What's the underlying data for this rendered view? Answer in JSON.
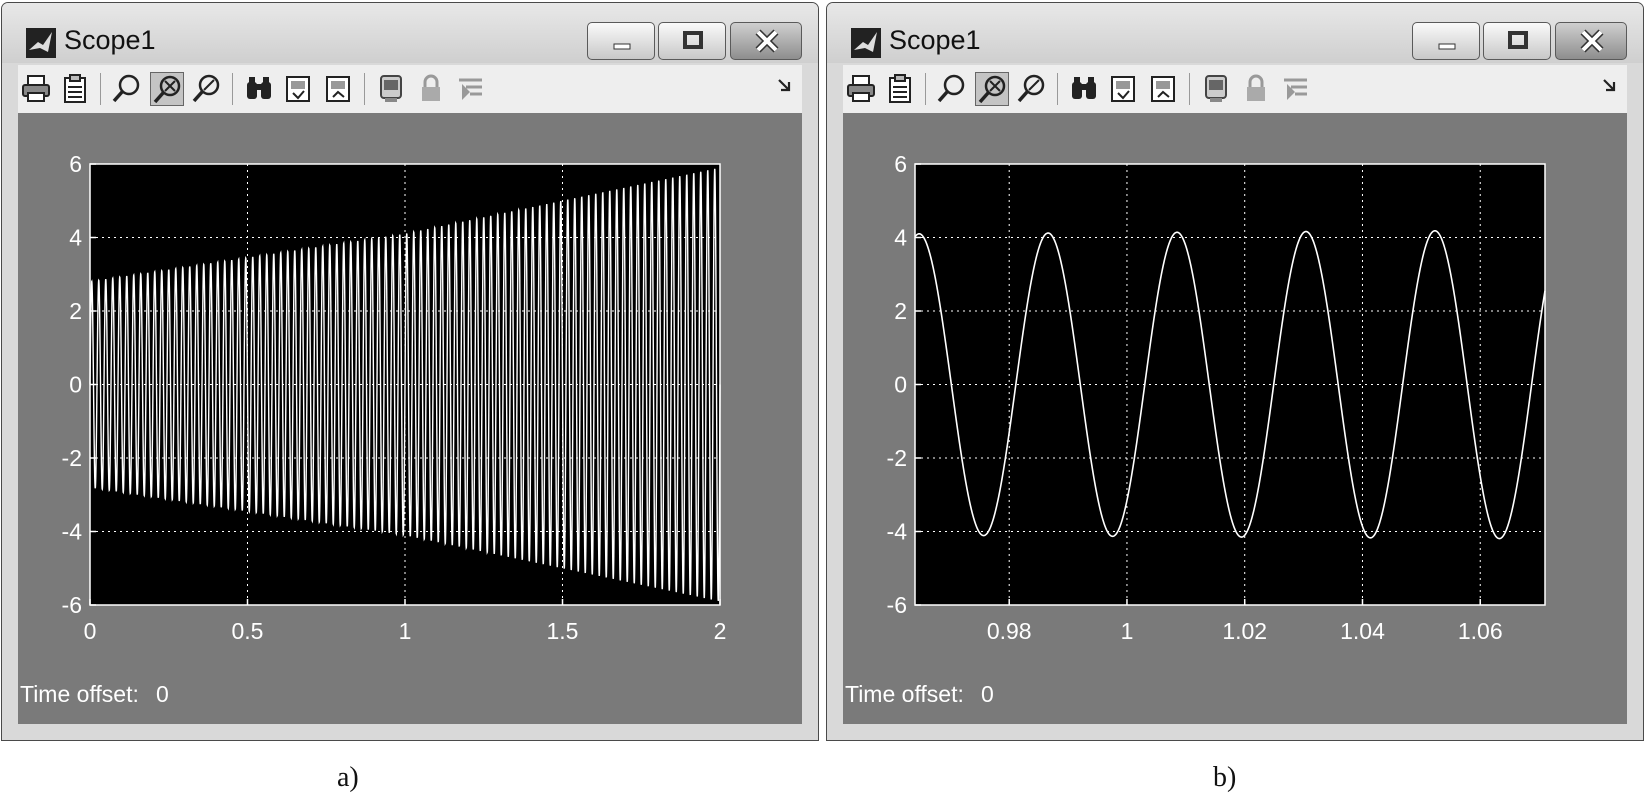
{
  "windows": [
    {
      "title": "Scope1",
      "time_offset_label": "Time offset:",
      "time_offset_value": "0",
      "caption": "a)"
    },
    {
      "title": "Scope1",
      "time_offset_label": "Time offset:",
      "time_offset_value": "0",
      "caption": "b)"
    }
  ],
  "toolbar_icons": [
    "print-icon",
    "parameters-icon",
    "zoom-icon",
    "zoom-x-icon",
    "zoom-y-icon",
    "autoscale-icon",
    "save-axes-icon",
    "restore-axes-icon",
    "floating-scope-icon",
    "lock-axes-icon",
    "signal-selection-icon",
    "dock-icon"
  ],
  "colors": {
    "plot_bg": "#000000",
    "trace": "#ffffff",
    "frame": "#7a7a7a",
    "grid": "#ffffff"
  },
  "chart_data": [
    {
      "type": "line",
      "title": "",
      "xlabel": "",
      "ylabel": "",
      "xlim": [
        0,
        2
      ],
      "ylim": [
        -6,
        6
      ],
      "xticks": [
        "0",
        "0.5",
        "1",
        "1.5",
        "2"
      ],
      "yticks": [
        "-6",
        "-4",
        "-2",
        "0",
        "2",
        "4",
        "6"
      ],
      "grid": true,
      "series": [
        {
          "signal": "sine",
          "frequency_hz": 45,
          "envelope_t": [
            0,
            1,
            2
          ],
          "amplitude": [
            2.8,
            4.1,
            5.9
          ]
        }
      ]
    },
    {
      "type": "line",
      "title": "",
      "xlabel": "",
      "ylabel": "",
      "xlim": [
        0.964,
        1.071
      ],
      "ylim": [
        -6,
        6
      ],
      "xticks": [
        "0.98",
        "1",
        "1.02",
        "1.04",
        "1.06"
      ],
      "yticks": [
        "-6",
        "-4",
        "-2",
        "0",
        "2",
        "4",
        "6"
      ],
      "grid": true,
      "series": [
        {
          "signal": "sine",
          "period_s": 0.0219,
          "amplitude": [
            4.1,
            4.2
          ],
          "peak_times": [
            0.9866,
            1.0085,
            1.0304,
            1.0523
          ],
          "trough_times": [
            0.9756,
            0.9975,
            1.0194,
            1.0413,
            1.0632
          ]
        }
      ]
    }
  ]
}
